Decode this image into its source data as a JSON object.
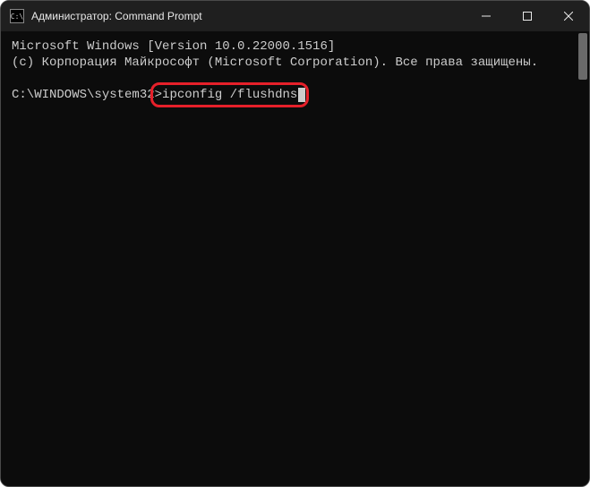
{
  "window": {
    "title": "Администратор: Command Prompt",
    "icon_label": "cmd-icon"
  },
  "terminal": {
    "line1": "Microsoft Windows [Version 10.0.22000.1516]",
    "line2": "(c) Корпорация Майкрософт (Microsoft Corporation). Все права защищены.",
    "blank": "",
    "prompt_path": "C:\\WINDOWS\\system32",
    "prompt_symbol": ">",
    "command": "ipconfig /flushdns"
  },
  "highlight": {
    "target": "command-input"
  }
}
